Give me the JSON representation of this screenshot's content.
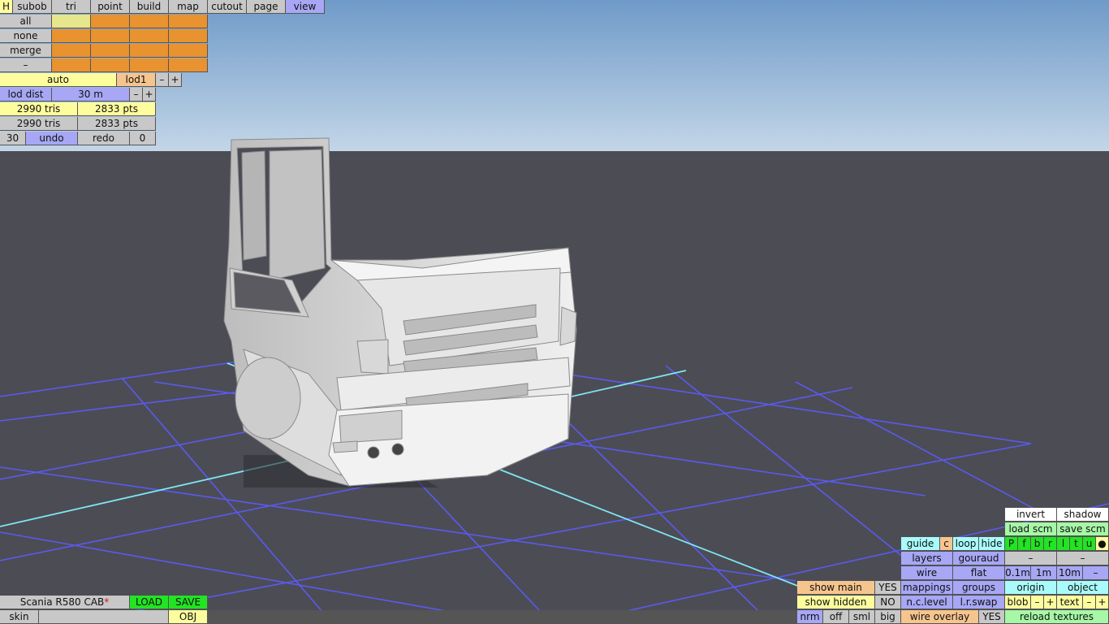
{
  "menu": {
    "h": "H",
    "tabs": [
      "subob",
      "tri",
      "point",
      "build",
      "map",
      "cutout",
      "page",
      "view"
    ]
  },
  "select": {
    "all": "all",
    "none": "none",
    "merge": "merge",
    "minus": "–"
  },
  "lod": {
    "auto": "auto",
    "lod1": "lod1",
    "minus": "–",
    "plus": "+",
    "lod_dist_label": "lod dist",
    "lod_dist_value": "30 m"
  },
  "stats": {
    "tris1": "2990 tris",
    "pts1": "2833 pts",
    "tris2": "2990 tris",
    "pts2": "2833 pts"
  },
  "history": {
    "count": "30",
    "undo": "undo",
    "redo": "redo",
    "redo_count": "0"
  },
  "file": {
    "name": "Scania R580 CAB",
    "modified_mark": "*",
    "load": "LOAD",
    "save": "SAVE",
    "skin": "skin",
    "obj": "OBJ"
  },
  "panel": {
    "invert": "invert",
    "shadow": "shadow",
    "load_scm": "load scm",
    "save_scm": "save scm",
    "guide": "guide",
    "c": "c",
    "loop": "loop",
    "hide": "hide",
    "views": [
      "P",
      "f",
      "b",
      "r",
      "l",
      "t",
      "u",
      "●"
    ],
    "layers": "layers",
    "gouraud": "gouraud",
    "dash": "–",
    "wire": "wire",
    "flat": "flat",
    "g01": "0.1m",
    "g1": "1m",
    "g10": "10m",
    "show_main": "show main",
    "yes": "YES",
    "mappings": "mappings",
    "groups": "groups",
    "origin": "origin",
    "object": "object",
    "show_hidden": "show hidden",
    "no": "NO",
    "nclevel": "n.c.level",
    "lrswap": "l.r.swap",
    "blob": "blob",
    "text": "text",
    "plus": "+",
    "nrm": "nrm",
    "off": "off",
    "sml": "sml",
    "big": "big",
    "wire_overlay": "wire overlay",
    "reload": "reload textures"
  },
  "colors": {
    "sky_top": "#6f9ac8",
    "sky_bottom": "#c3d6e8",
    "floor": "#4c4c55",
    "grid": "#5a5af0",
    "axis": "#7fe6f0",
    "model": "#e2e2e2"
  }
}
